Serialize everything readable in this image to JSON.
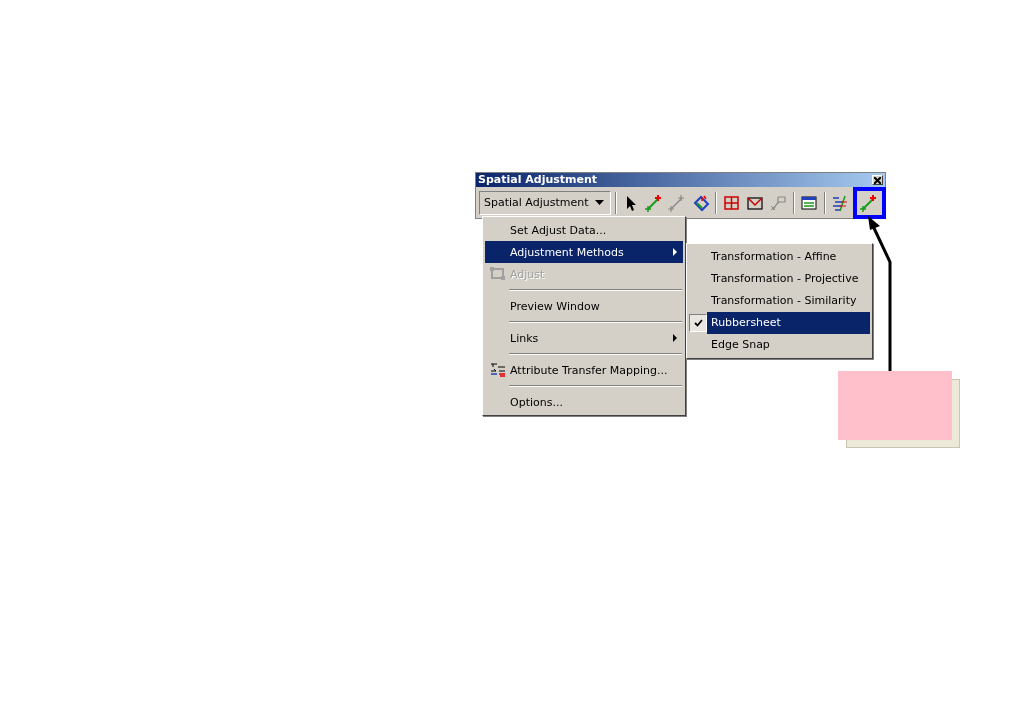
{
  "window": {
    "title": "Spatial Adjustment"
  },
  "toolbar": {
    "dropdown": "Spatial Adjustment",
    "tools": [
      {
        "kind": "select",
        "disabled": false,
        "highlighted": false,
        "divider_before": true
      },
      {
        "kind": "new-link",
        "disabled": false,
        "highlighted": false,
        "divider_before": false
      },
      {
        "kind": "modify-link",
        "disabled": true,
        "highlighted": false,
        "divider_before": false
      },
      {
        "kind": "multi-link",
        "disabled": false,
        "highlighted": false,
        "divider_before": false
      },
      {
        "kind": "grid",
        "disabled": false,
        "highlighted": false,
        "divider_before": true
      },
      {
        "kind": "area",
        "disabled": false,
        "highlighted": false,
        "divider_before": false
      },
      {
        "kind": "flag",
        "disabled": true,
        "highlighted": false,
        "divider_before": false
      },
      {
        "kind": "table",
        "disabled": false,
        "highlighted": false,
        "divider_before": true
      },
      {
        "kind": "lines",
        "disabled": false,
        "highlighted": false,
        "divider_before": true
      },
      {
        "kind": "new-link",
        "disabled": false,
        "highlighted": true,
        "divider_before": false
      }
    ]
  },
  "menu": {
    "items": [
      {
        "label": "Set Adjust Data...",
        "kind": "plain",
        "selected": false,
        "disabled": false,
        "submenu": false,
        "divider_above": false
      },
      {
        "label": "Adjustment Methods",
        "kind": "plain",
        "selected": true,
        "disabled": false,
        "submenu": true,
        "divider_above": false
      },
      {
        "label": "Adjust",
        "kind": "adjust",
        "selected": false,
        "disabled": true,
        "submenu": false,
        "divider_above": false
      },
      {
        "label": "Preview Window",
        "kind": "plain",
        "selected": false,
        "disabled": false,
        "submenu": false,
        "divider_above": true
      },
      {
        "label": "Links",
        "kind": "plain",
        "selected": false,
        "disabled": false,
        "submenu": true,
        "divider_above": true
      },
      {
        "label": "Attribute Transfer Mapping...",
        "kind": "mapping",
        "selected": false,
        "disabled": false,
        "submenu": false,
        "divider_above": true
      },
      {
        "label": "Options...",
        "kind": "plain",
        "selected": false,
        "disabled": false,
        "submenu": false,
        "divider_above": true
      }
    ]
  },
  "submenu": {
    "items": [
      {
        "label": "Transformation - Affine",
        "checked": false,
        "selected": false
      },
      {
        "label": "Transformation - Projective",
        "checked": false,
        "selected": false
      },
      {
        "label": "Transformation - Similarity",
        "checked": false,
        "selected": false
      },
      {
        "label": "Rubbersheet",
        "checked": true,
        "selected": true
      },
      {
        "label": "Edge Snap",
        "checked": false,
        "selected": false
      }
    ]
  },
  "callout": {
    "shadow": true
  }
}
